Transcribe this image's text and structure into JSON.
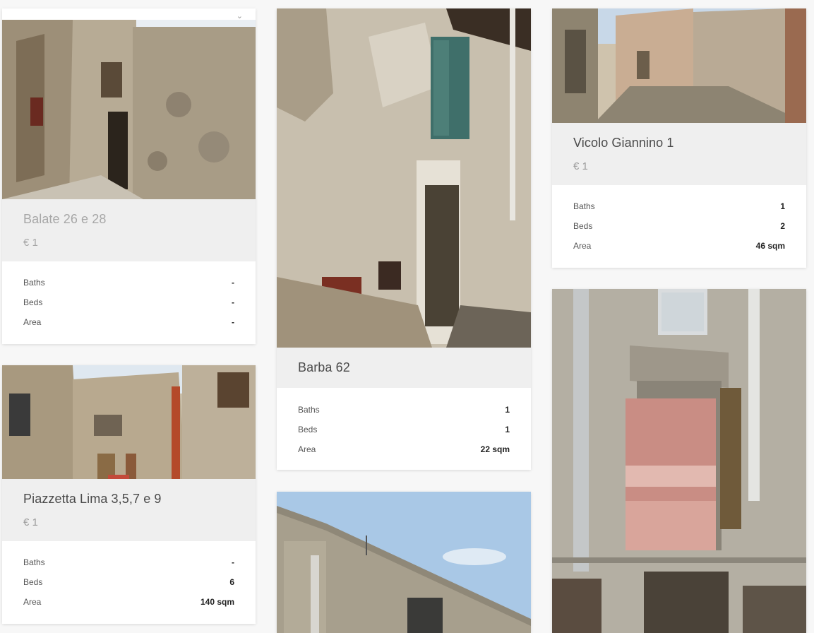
{
  "stat_labels": {
    "baths": "Baths",
    "beds": "Beds",
    "area": "Area"
  },
  "listings": {
    "balate": {
      "title": "Balate 26 e 28",
      "price": "€ 1",
      "baths": "-",
      "beds": "-",
      "area": "-",
      "photo": "stone-facade-street"
    },
    "piazzetta": {
      "title": "Piazzetta Lima 3,5,7 e 9",
      "price": "€ 1",
      "baths": "-",
      "beds": "6",
      "area": "140 sqm",
      "photo": "square-with-buildings"
    },
    "barba": {
      "title": "Barba 62",
      "price": "",
      "baths": "1",
      "beds": "1",
      "area": "22 sqm",
      "photo": "weathered-wall-door"
    },
    "vicolo": {
      "title": "Vicolo Giannino 1",
      "price": "€ 1",
      "baths": "1",
      "beds": "2",
      "area": "46 sqm",
      "photo": "narrow-alley"
    },
    "bottom_middle": {
      "photo": "rooftop-sky"
    },
    "bottom_right": {
      "photo": "facade-with-shutter"
    }
  },
  "icons": {
    "chevron": "chevron-down-icon"
  }
}
